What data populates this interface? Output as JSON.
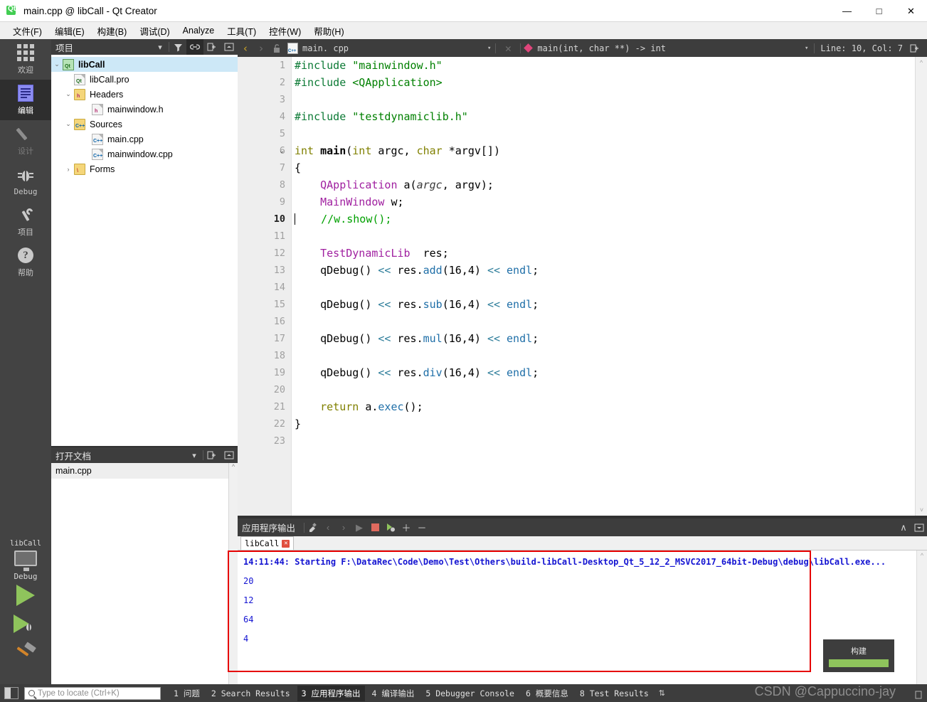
{
  "window": {
    "title": "main.cpp @ libCall - Qt Creator",
    "app_icon": "qt-logo-icon",
    "controls": {
      "minimize": "—",
      "maximize": "□",
      "close": "✕"
    }
  },
  "menubar": {
    "items": [
      {
        "label": "文件(F)",
        "name": "menu-file"
      },
      {
        "label": "编辑(E)",
        "name": "menu-edit"
      },
      {
        "label": "构建(B)",
        "name": "menu-build"
      },
      {
        "label": "调试(D)",
        "name": "menu-debug"
      },
      {
        "label": "Analyze",
        "name": "menu-analyze"
      },
      {
        "label": "工具(T)",
        "name": "menu-tools"
      },
      {
        "label": "控件(W)",
        "name": "menu-window"
      },
      {
        "label": "帮助(H)",
        "name": "menu-help"
      }
    ]
  },
  "modebar": {
    "items": [
      {
        "label": "欢迎",
        "icon": "grid-icon",
        "state": "normal"
      },
      {
        "label": "编辑",
        "icon": "edit-document-icon",
        "state": "active"
      },
      {
        "label": "设计",
        "icon": "pencil-icon",
        "state": "disabled"
      },
      {
        "label": "Debug",
        "icon": "bug-icon",
        "state": "normal"
      },
      {
        "label": "项目",
        "icon": "wrench-icon",
        "state": "normal"
      },
      {
        "label": "帮助",
        "icon": "question-mark-icon",
        "state": "normal"
      }
    ],
    "run_controls": {
      "kit_name": "libCall",
      "kit_icon": "desktop-monitor-icon",
      "build_config": "Debug",
      "run_button": "run-play-icon",
      "debug_button": "debug-play-icon",
      "build_button": "hammer-icon"
    }
  },
  "project_panel": {
    "title": "项目",
    "header_buttons": [
      {
        "name": "panel-dropdown",
        "glyph": "▾"
      },
      {
        "name": "filter-icon",
        "glyph": "filter"
      },
      {
        "name": "link-icon",
        "glyph": "link",
        "active": true
      },
      {
        "name": "split-icon",
        "glyph": "split"
      },
      {
        "name": "collapse-icon",
        "glyph": "collapse"
      }
    ],
    "tree": [
      {
        "label": "libCall",
        "icon": "qt-project-icon",
        "depth": 0,
        "arrow": "⌄",
        "selected": true,
        "bold": true
      },
      {
        "label": "libCall.pro",
        "icon": "qt-pro-file-icon",
        "depth": 1,
        "arrow": ""
      },
      {
        "label": "Headers",
        "icon": "folder-headers-icon",
        "depth": 1,
        "arrow": "⌄"
      },
      {
        "label": "mainwindow.h",
        "icon": "header-file-icon",
        "depth": 2,
        "arrow": ""
      },
      {
        "label": "Sources",
        "icon": "folder-sources-icon",
        "depth": 1,
        "arrow": "⌄"
      },
      {
        "label": "main.cpp",
        "icon": "cpp-file-icon",
        "depth": 2,
        "arrow": ""
      },
      {
        "label": "mainwindow.cpp",
        "icon": "cpp-file-icon",
        "depth": 2,
        "arrow": ""
      },
      {
        "label": "Forms",
        "icon": "folder-forms-icon",
        "depth": 1,
        "arrow": "›"
      }
    ]
  },
  "open_documents_panel": {
    "title": "打开文档",
    "header_buttons": [
      {
        "name": "open-docs-dropdown",
        "glyph": "▾"
      },
      {
        "name": "split-icon",
        "glyph": "split"
      },
      {
        "name": "collapse-icon",
        "glyph": "collapse"
      }
    ],
    "documents": [
      {
        "label": "main.cpp",
        "selected": true
      }
    ]
  },
  "editor": {
    "toolbar": {
      "back_icon": "back-arrow-icon",
      "forward_icon": "forward-arrow-icon",
      "lock_icon": "unlock-icon",
      "file_icon": "cpp-file-icon",
      "filename": "main. cpp",
      "file_dropdown": "▾",
      "close_icon": "✕",
      "symbol_icon": "function-diamond-icon",
      "symbol": "main(int, char **) -> int",
      "symbol_dropdown": "▾",
      "cursor_position": "Line: 10, Col: 7",
      "split_icon": "split-icon"
    },
    "cursor_line": 10,
    "lines": [
      {
        "n": 1,
        "fold": "",
        "tokens": [
          {
            "t": "#include ",
            "c": "k-pre"
          },
          {
            "t": "\"mainwindow.h\"",
            "c": "k-str"
          }
        ]
      },
      {
        "n": 2,
        "fold": "",
        "tokens": [
          {
            "t": "#include ",
            "c": "k-pre"
          },
          {
            "t": "<QApplication>",
            "c": "k-str"
          }
        ]
      },
      {
        "n": 3,
        "fold": "",
        "tokens": []
      },
      {
        "n": 4,
        "fold": "",
        "tokens": [
          {
            "t": "#include ",
            "c": "k-pre"
          },
          {
            "t": "\"testdynamiclib.h\"",
            "c": "k-str"
          }
        ]
      },
      {
        "n": 5,
        "fold": "",
        "tokens": []
      },
      {
        "n": 6,
        "fold": "⌄",
        "tokens": [
          {
            "t": "int ",
            "c": "k-kw"
          },
          {
            "t": "main",
            "c": "k-fn"
          },
          {
            "t": "(",
            "c": "k-plain"
          },
          {
            "t": "int",
            "c": "k-kw"
          },
          {
            "t": " argc, ",
            "c": "k-plain"
          },
          {
            "t": "char",
            "c": "k-kw"
          },
          {
            "t": " *argv[])",
            "c": "k-plain"
          }
        ]
      },
      {
        "n": 7,
        "fold": "",
        "tokens": [
          {
            "t": "{",
            "c": "k-plain"
          }
        ]
      },
      {
        "n": 8,
        "fold": "",
        "tokens": [
          {
            "t": "    ",
            "c": "k-plain"
          },
          {
            "t": "QApplication",
            "c": "k-type"
          },
          {
            "t": " a(",
            "c": "k-plain"
          },
          {
            "t": "argc",
            "c": "k-par"
          },
          {
            "t": ", argv);",
            "c": "k-plain"
          }
        ]
      },
      {
        "n": 9,
        "fold": "",
        "tokens": [
          {
            "t": "    ",
            "c": "k-plain"
          },
          {
            "t": "MainWindow",
            "c": "k-type"
          },
          {
            "t": " w;",
            "c": "k-plain"
          }
        ]
      },
      {
        "n": 10,
        "fold": "",
        "tokens": [
          {
            "t": "    ",
            "c": "k-plain"
          },
          {
            "t": "//w.show();",
            "c": "k-cmt"
          }
        ]
      },
      {
        "n": 11,
        "fold": "",
        "tokens": []
      },
      {
        "n": 12,
        "fold": "",
        "tokens": [
          {
            "t": "    ",
            "c": "k-plain"
          },
          {
            "t": "TestDynamicLib",
            "c": "k-type"
          },
          {
            "t": "  res;",
            "c": "k-plain"
          }
        ]
      },
      {
        "n": 13,
        "fold": "",
        "tokens": [
          {
            "t": "    qDebug() ",
            "c": "k-plain"
          },
          {
            "t": "<<",
            "c": "k-op"
          },
          {
            "t": " res.",
            "c": "k-plain"
          },
          {
            "t": "add",
            "c": "k-mem"
          },
          {
            "t": "(16,4) ",
            "c": "k-plain"
          },
          {
            "t": "<<",
            "c": "k-op"
          },
          {
            "t": " ",
            "c": "k-plain"
          },
          {
            "t": "endl",
            "c": "k-mem"
          },
          {
            "t": ";",
            "c": "k-plain"
          }
        ]
      },
      {
        "n": 14,
        "fold": "",
        "tokens": []
      },
      {
        "n": 15,
        "fold": "",
        "tokens": [
          {
            "t": "    qDebug() ",
            "c": "k-plain"
          },
          {
            "t": "<<",
            "c": "k-op"
          },
          {
            "t": " res.",
            "c": "k-plain"
          },
          {
            "t": "sub",
            "c": "k-mem"
          },
          {
            "t": "(16,4) ",
            "c": "k-plain"
          },
          {
            "t": "<<",
            "c": "k-op"
          },
          {
            "t": " ",
            "c": "k-plain"
          },
          {
            "t": "endl",
            "c": "k-mem"
          },
          {
            "t": ";",
            "c": "k-plain"
          }
        ]
      },
      {
        "n": 16,
        "fold": "",
        "tokens": []
      },
      {
        "n": 17,
        "fold": "",
        "tokens": [
          {
            "t": "    qDebug() ",
            "c": "k-plain"
          },
          {
            "t": "<<",
            "c": "k-op"
          },
          {
            "t": " res.",
            "c": "k-plain"
          },
          {
            "t": "mul",
            "c": "k-mem"
          },
          {
            "t": "(16,4) ",
            "c": "k-plain"
          },
          {
            "t": "<<",
            "c": "k-op"
          },
          {
            "t": " ",
            "c": "k-plain"
          },
          {
            "t": "endl",
            "c": "k-mem"
          },
          {
            "t": ";",
            "c": "k-plain"
          }
        ]
      },
      {
        "n": 18,
        "fold": "",
        "tokens": []
      },
      {
        "n": 19,
        "fold": "",
        "tokens": [
          {
            "t": "    qDebug() ",
            "c": "k-plain"
          },
          {
            "t": "<<",
            "c": "k-op"
          },
          {
            "t": " res.",
            "c": "k-plain"
          },
          {
            "t": "div",
            "c": "k-mem"
          },
          {
            "t": "(16,4) ",
            "c": "k-plain"
          },
          {
            "t": "<<",
            "c": "k-op"
          },
          {
            "t": " ",
            "c": "k-plain"
          },
          {
            "t": "endl",
            "c": "k-mem"
          },
          {
            "t": ";",
            "c": "k-plain"
          }
        ]
      },
      {
        "n": 20,
        "fold": "",
        "tokens": []
      },
      {
        "n": 21,
        "fold": "",
        "tokens": [
          {
            "t": "    ",
            "c": "k-plain"
          },
          {
            "t": "return",
            "c": "k-kw"
          },
          {
            "t": " a.",
            "c": "k-plain"
          },
          {
            "t": "exec",
            "c": "k-mem"
          },
          {
            "t": "();",
            "c": "k-plain"
          }
        ]
      },
      {
        "n": 22,
        "fold": "",
        "tokens": [
          {
            "t": "}",
            "c": "k-plain"
          }
        ]
      },
      {
        "n": 23,
        "fold": "",
        "tokens": []
      }
    ]
  },
  "output_pane": {
    "title": "应用程序输出",
    "toolbar_buttons": [
      {
        "name": "clear-output-icon",
        "glyph": "clear"
      },
      {
        "name": "prev-item-icon",
        "glyph": "‹"
      },
      {
        "name": "next-item-icon",
        "glyph": "›"
      },
      {
        "name": "run-icon",
        "glyph": "▶"
      },
      {
        "name": "stop-icon",
        "glyph": "stop"
      },
      {
        "name": "debug-run-icon",
        "glyph": "debug"
      },
      {
        "name": "zoom-in-icon",
        "glyph": "＋"
      },
      {
        "name": "zoom-out-icon",
        "glyph": "－"
      }
    ],
    "right_buttons": [
      {
        "name": "minimize-pane-icon",
        "glyph": "∧"
      },
      {
        "name": "maximize-pane-icon",
        "glyph": "maximize"
      }
    ],
    "tabs": [
      {
        "label": "libCall",
        "close": "✕",
        "active": true
      }
    ],
    "lines": [
      {
        "text": "14:11:44: Starting F:\\DataRec\\Code\\Demo\\Test\\Others\\build-libCall-Desktop_Qt_5_12_2_MSVC2017_64bit-Debug\\debug\\libCall.exe...",
        "style": "bold"
      },
      {
        "text": "20",
        "style": "num"
      },
      {
        "text": "12",
        "style": "num"
      },
      {
        "text": "64",
        "style": "num"
      },
      {
        "text": "4",
        "style": "num"
      }
    ]
  },
  "build_popup": {
    "label": "构建",
    "progress": 100,
    "bar_color": "#8fc45c"
  },
  "watermark": "CSDN @Cappuccino-jay",
  "statusbar": {
    "sidebar_toggle": "sidebar-toggle-icon",
    "locator_placeholder": "Type to locate (Ctrl+K)",
    "locator_value": "",
    "tabs": [
      {
        "num": "1",
        "label": "问题",
        "active": false
      },
      {
        "num": "2",
        "label": "Search Results",
        "active": false
      },
      {
        "num": "3",
        "label": "应用程序输出",
        "active": true
      },
      {
        "num": "4",
        "label": "编译输出",
        "active": false
      },
      {
        "num": "5",
        "label": "Debugger Console",
        "active": false
      },
      {
        "num": "6",
        "label": "概要信息",
        "active": false
      },
      {
        "num": "8",
        "label": "Test Results",
        "active": false
      }
    ],
    "updown": "⇅"
  },
  "colors": {
    "accent_green": "#8fc45c",
    "panel_dark": "#3d3d3d",
    "modebar": "#434343",
    "selection_blue": "#cde8f7",
    "output_text": "#1414d2",
    "redbox": "#e60000"
  }
}
